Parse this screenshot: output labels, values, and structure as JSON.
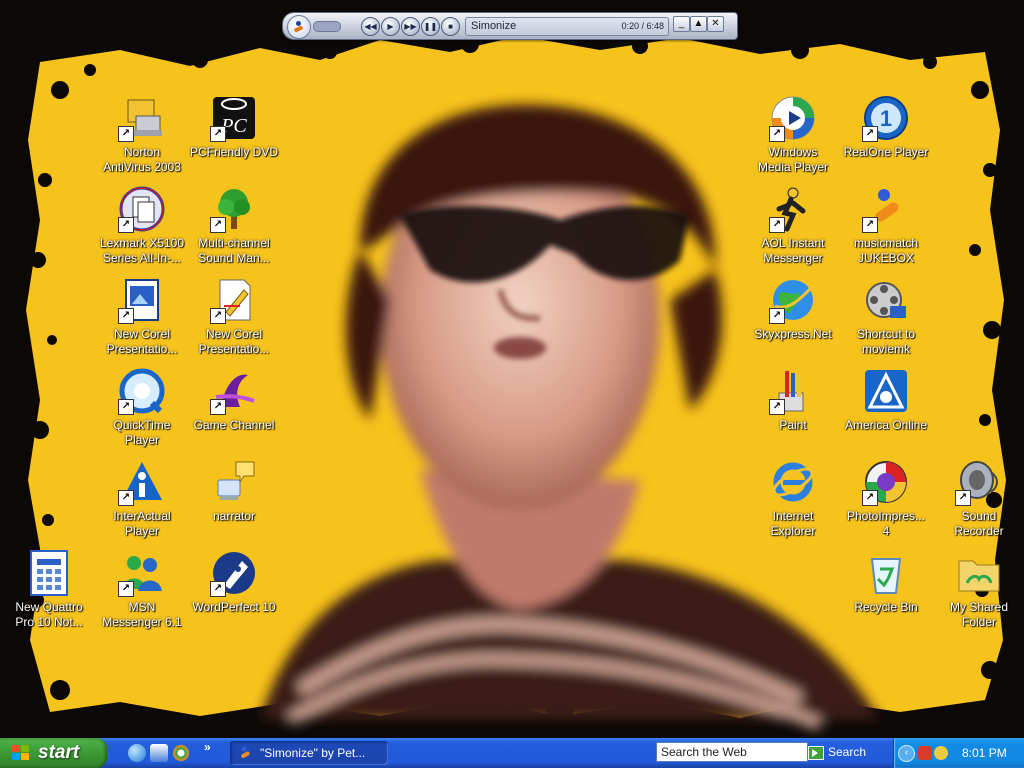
{
  "media_player": {
    "track": "Simonize",
    "time": "0:20 / 6:48",
    "buttons": [
      "prev",
      "play",
      "next",
      "pause",
      "stop"
    ],
    "window_controls": [
      "_",
      "▲",
      "✕"
    ]
  },
  "desktop_icons": [
    {
      "key": "norton",
      "label": "Norton\nAntiVirus 2003",
      "icon": "norton-antivirus-icon",
      "shortcut": true
    },
    {
      "key": "pcfriendly",
      "label": "PCFriendly DVD",
      "icon": "pcfriendly-icon",
      "shortcut": true
    },
    {
      "key": "lexmark",
      "label": "Lexmark X5100\nSeries All-In-...",
      "icon": "lexmark-icon",
      "shortcut": true
    },
    {
      "key": "multichannel",
      "label": "Multi-channel\nSound Man...",
      "icon": "tree-icon",
      "shortcut": true
    },
    {
      "key": "corel1",
      "label": "New Corel\nPresentatio...",
      "icon": "corel-presentation-icon",
      "shortcut": true
    },
    {
      "key": "corel2",
      "label": "New Corel\nPresentatio...",
      "icon": "corel-drawing-icon",
      "shortcut": true
    },
    {
      "key": "quicktime",
      "label": "QuickTime\nPlayer",
      "icon": "quicktime-icon",
      "shortcut": true
    },
    {
      "key": "gamechannel",
      "label": "Game Channel",
      "icon": "game-channel-icon",
      "shortcut": true
    },
    {
      "key": "interactual",
      "label": "InterActual\nPlayer",
      "icon": "interactual-icon",
      "shortcut": true
    },
    {
      "key": "narrator",
      "label": "narrator",
      "icon": "narrator-icon",
      "shortcut": false
    },
    {
      "key": "quattro",
      "label": "New Quattro\nPro 10 Not...",
      "icon": "quattro-pro-icon",
      "shortcut": false
    },
    {
      "key": "msn",
      "label": "MSN\nMessenger 6.1",
      "icon": "msn-messenger-icon",
      "shortcut": true
    },
    {
      "key": "wordperfect",
      "label": "WordPerfect 10",
      "icon": "wordperfect-icon",
      "shortcut": true
    },
    {
      "key": "wmp",
      "label": "Windows\nMedia Player",
      "icon": "windows-media-player-icon",
      "shortcut": true
    },
    {
      "key": "realone",
      "label": "RealOne Player",
      "icon": "realone-icon",
      "shortcut": true
    },
    {
      "key": "aim",
      "label": "AOL Instant\nMessenger",
      "icon": "aim-icon",
      "shortcut": true
    },
    {
      "key": "musicmatch",
      "label": "musicmatch\nJUKEBOX",
      "icon": "musicmatch-icon",
      "shortcut": true
    },
    {
      "key": "skyxpress",
      "label": "Skyxpress.Net",
      "icon": "globe-icon",
      "shortcut": true
    },
    {
      "key": "moviemk",
      "label": "Shortcut to\nmoviemk",
      "icon": "movie-maker-icon",
      "shortcut": false
    },
    {
      "key": "paint",
      "label": "Paint",
      "icon": "paint-icon",
      "shortcut": true
    },
    {
      "key": "aol",
      "label": "America Online",
      "icon": "america-online-icon",
      "shortcut": false
    },
    {
      "key": "ie",
      "label": "Internet\nExplorer",
      "icon": "internet-explorer-icon",
      "shortcut": false
    },
    {
      "key": "photoimpression",
      "label": "PhotoImpres...\n4",
      "icon": "photoimpression-icon",
      "shortcut": true
    },
    {
      "key": "soundrecorder",
      "label": "Sound\nRecorder",
      "icon": "sound-recorder-icon",
      "shortcut": true
    },
    {
      "key": "recyclebin",
      "label": "Recycle Bin",
      "icon": "recycle-bin-icon",
      "shortcut": false
    },
    {
      "key": "sharedfolder",
      "label": "My Shared\nFolder",
      "icon": "shared-folder-icon",
      "shortcut": false
    }
  ],
  "taskbar": {
    "start_label": "start",
    "quick_launch": [
      "internet-explorer-icon",
      "outlook-icon",
      "windows-media-player-icon"
    ],
    "quick_launch_more": "»",
    "task_item": "\"Simonize\" by Pet...",
    "search_placeholder": "Search the Web",
    "search_button": "Search",
    "clock": "8:01 PM"
  },
  "colors": {
    "wallpaper_yellow": "#f6c21c",
    "taskbar_blue": "#245edc",
    "start_green": "#3c9a35",
    "tray_blue": "#138be6"
  }
}
